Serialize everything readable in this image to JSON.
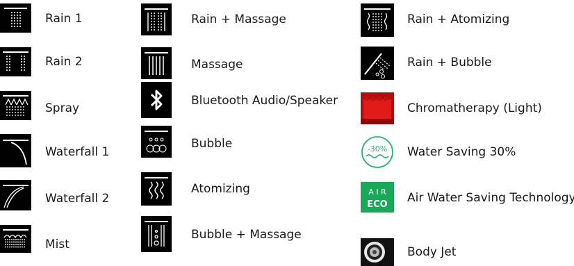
{
  "columns": [
    {
      "items": [
        {
          "icon": "rain-1-icon",
          "label": "Rain 1"
        },
        {
          "icon": "rain-2-icon",
          "label": "Rain 2"
        },
        {
          "icon": "spray-icon",
          "label": "Spray"
        },
        {
          "icon": "waterfall-1-icon",
          "label": "Waterfall 1"
        },
        {
          "icon": "waterfall-2-icon",
          "label": "Waterfall 2"
        },
        {
          "icon": "mist-icon",
          "label": "Mist"
        }
      ]
    },
    {
      "items": [
        {
          "icon": "rain-massage-icon",
          "label": "Rain + Massage"
        },
        {
          "icon": "massage-icon",
          "label": "Massage"
        },
        {
          "icon": "bluetooth-icon",
          "label": "Bluetooth Audio/Speaker"
        },
        {
          "icon": "bubble-icon",
          "label": "Bubble"
        },
        {
          "icon": "atomizing-icon",
          "label": "Atomizing"
        },
        {
          "icon": "bubble-massage-icon",
          "label": "Bubble + Massage"
        }
      ]
    },
    {
      "items": [
        {
          "icon": "rain-atomizing-icon",
          "label": "Rain + Atomizing"
        },
        {
          "icon": "rain-bubble-icon",
          "label": "Rain + Bubble"
        },
        {
          "icon": "chromatherapy-icon",
          "label": "Chromatherapy (Light)"
        },
        {
          "icon": "water-saving-icon",
          "label": "Water Saving 30%",
          "badge": "-30%"
        },
        {
          "icon": "air-eco-icon",
          "label": "Air Water Saving Technology",
          "badge_top": "A I R",
          "badge_bottom": "ECO"
        },
        {
          "icon": "body-jet-icon",
          "label": "Body Jet"
        }
      ]
    }
  ],
  "colors": {
    "icon_bg": "#000000",
    "chroma_red": "#c41010",
    "eco_green": "#18a85a",
    "saving_green": "#2db36b"
  }
}
